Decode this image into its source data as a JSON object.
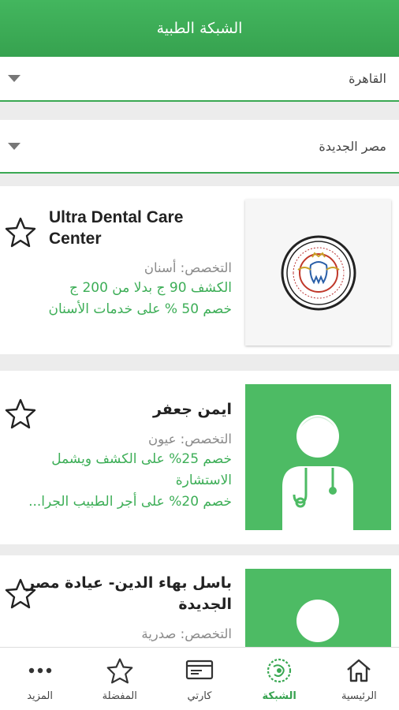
{
  "header": {
    "title": "الشبكة الطبية"
  },
  "filters": {
    "city": "القاهرة",
    "area": "مصر الجديدة"
  },
  "providers": [
    {
      "name": "Ultra Dental Care Center",
      "specialty": "التخصص: أسنان",
      "offers": [
        "الكشف 90 ج بدلا من 200 ج",
        "خصم 50 % على خدمات الأسنان"
      ],
      "logo_text": "Ultra Dental Care Clinic"
    },
    {
      "name": "ايمن جعفر",
      "specialty": "التخصص: عيون",
      "offers": [
        "خصم 25% على الكشف ويشمل الاستشارة",
        "خصم 20% على أجر الطبيب الجرا..."
      ]
    },
    {
      "name": "باسل بهاء الدين- عيادة مصر الجديدة",
      "specialty": "التخصص: صدرية",
      "offers": []
    }
  ],
  "bottom_nav": [
    {
      "label": "الرئيسية",
      "icon": "home-icon"
    },
    {
      "label": "الشبكة",
      "icon": "network-icon",
      "active": true
    },
    {
      "label": "كارتي",
      "icon": "card-icon"
    },
    {
      "label": "المفضلة",
      "icon": "star-icon"
    },
    {
      "label": "المزيد",
      "icon": "more-icon"
    }
  ],
  "colors": {
    "primary": "#3aa853",
    "offer_text": "#3dae57",
    "doctor_bg": "#4dbb64"
  }
}
